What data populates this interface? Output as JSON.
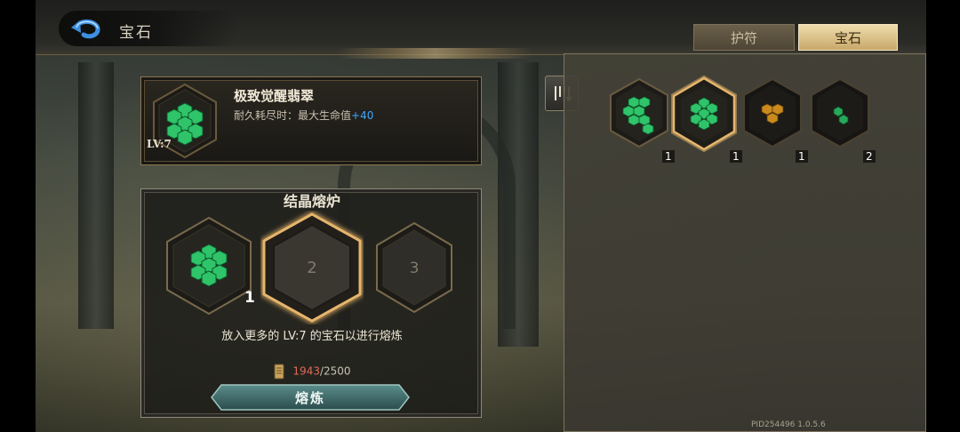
{
  "header": {
    "title": "宝石",
    "tabs": [
      {
        "label": "护符",
        "active": false
      },
      {
        "label": "宝石",
        "active": true
      }
    ]
  },
  "gem_info": {
    "name": "极致觉醒翡翠",
    "desc_prefix": "耐久耗尽时：最大生命值",
    "desc_bonus": "+40",
    "level": "LV:7"
  },
  "furnace": {
    "title": "结晶熔炉",
    "slot1_count": "1",
    "slot2_label": "2",
    "slot3_label": "3",
    "hint": "放入更多的 LV:7 的宝石以进行熔炼",
    "cost_current": "1943",
    "cost_total": "/2500",
    "button_label": "熔炼"
  },
  "inventory": {
    "items": [
      {
        "count": "1",
        "gem": "emerald-large",
        "selected": false
      },
      {
        "count": "1",
        "gem": "emerald-full",
        "selected": true
      },
      {
        "count": "1",
        "gem": "amber-small",
        "selected": false
      },
      {
        "count": "2",
        "gem": "emerald-tiny",
        "selected": false
      }
    ]
  },
  "version": "PID254496  1.0.5.6",
  "colors": {
    "accent_gold": "#d9a35a",
    "gem_green": "#2fc46a",
    "bonus_blue": "#3ea7ff",
    "cost_red": "#e06a5a",
    "button_teal": "#3f6f6f"
  }
}
